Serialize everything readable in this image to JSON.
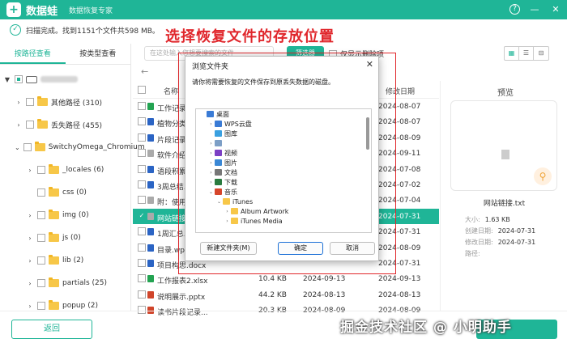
{
  "app": {
    "brand": "数据蛙",
    "subtitle": "数据恢复专家",
    "help": "?",
    "minimize": "—",
    "close": "✕",
    "logo": "+"
  },
  "status": {
    "text": "扫描完成。找到1151个文件共598 MB。"
  },
  "annotation": "选择恢复文件的存放位置",
  "tabs": [
    {
      "label": "按路径查看"
    },
    {
      "label": "按类型查看"
    }
  ],
  "tree": [
    {
      "label": "其他路径 (310)"
    },
    {
      "label": "丢失路径 (455)"
    },
    {
      "label": "SwitchyOmega_Chromium"
    },
    {
      "label": "_locales (6)"
    },
    {
      "label": "css (0)"
    },
    {
      "label": "img (0)"
    },
    {
      "label": "js (0)"
    },
    {
      "label": "lib (2)"
    },
    {
      "label": "partials (25)"
    },
    {
      "label": "popup (2)"
    }
  ],
  "toolbar": {
    "search_placeholder": "在这处输入您想要搜索的文件",
    "filter_label": "筛选器",
    "only_deleted": "仅显示删除项"
  },
  "view": {
    "grid": "▦",
    "list": "☰",
    "detail": "⊟"
  },
  "nav": {
    "back": "←"
  },
  "list": {
    "col_name": "名称",
    "col_date": "修改日期",
    "rows": [
      {
        "name": "工作记录表",
        "size": "",
        "type": "",
        "date": "2024-08-07",
        "icon": "x"
      },
      {
        "name": "植物分类.d",
        "size": "",
        "type": "",
        "date": "2024-08-07",
        "icon": "w"
      },
      {
        "name": "片段记录.d",
        "size": "",
        "type": "",
        "date": "2024-08-09",
        "icon": "w"
      },
      {
        "name": "软件介绍 -",
        "size": "",
        "type": "",
        "date": "2024-09-11",
        "icon": "t"
      },
      {
        "name": "语段积累.d",
        "size": "",
        "type": "",
        "date": "2024-07-08",
        "icon": "w"
      },
      {
        "name": "3周总结.do",
        "size": "",
        "type": "",
        "date": "2024-07-02",
        "icon": "w"
      },
      {
        "name": "附：使用流",
        "size": "",
        "type": "",
        "date": "2024-07-04",
        "icon": "t"
      },
      {
        "name": "网站链接.tx",
        "size": "",
        "type": "",
        "date": "2024-07-31",
        "icon": "t",
        "selected": true
      },
      {
        "name": "1周汇总.do",
        "size": "",
        "type": "",
        "date": "2024-07-31",
        "icon": "w"
      },
      {
        "name": "目录.wps",
        "size": "",
        "type": "",
        "date": "2024-08-09",
        "icon": "w"
      },
      {
        "name": "项目构思.docx",
        "size": "",
        "type": "",
        "date": "2024-07-31",
        "icon": "w"
      },
      {
        "name": "工作报表2.xlsx",
        "size": "10.4 KB",
        "type": "2024-09-13",
        "date": "2024-09-13",
        "icon": "x"
      },
      {
        "name": "说明展示.pptx",
        "size": "44.2 KB",
        "type": "2024-08-13",
        "date": "2024-08-13",
        "icon": "p"
      },
      {
        "name": "读书片段记录...",
        "size": "20.3 KB",
        "type": "2024-08-09",
        "date": "2024-08-09",
        "icon": "p"
      }
    ]
  },
  "preview": {
    "title": "预览",
    "filename": "网站链接.txt",
    "size_label": "大小:",
    "size": "1.63 KB",
    "created_label": "创建日期:",
    "created": "2024-07-31",
    "modified_label": "修改日期:",
    "modified": "2024-07-31",
    "path_label": "路径:",
    "magnifier": "⚲"
  },
  "dialog": {
    "title": "浏览文件夹",
    "close": "✕",
    "message": "请你将需要恢复的文件保存到原丢失数据的磁盘。",
    "tree": [
      {
        "label": "桌面",
        "indent": 0,
        "chev": "",
        "color": "#3a7bd5"
      },
      {
        "label": "WPS云盘",
        "indent": 1,
        "chev": "›",
        "color": "#3a7bd5"
      },
      {
        "label": "图库",
        "indent": 1,
        "chev": "",
        "color": "#3aa0e0"
      },
      {
        "label": "",
        "indent": 1,
        "chev": "›",
        "color": "#7d9fc6"
      },
      {
        "label": "视频",
        "indent": 1,
        "chev": "›",
        "color": "#7b3fc4"
      },
      {
        "label": "图片",
        "indent": 1,
        "chev": "›",
        "color": "#3a87d5"
      },
      {
        "label": "文档",
        "indent": 1,
        "chev": "›",
        "color": "#777"
      },
      {
        "label": "下载",
        "indent": 1,
        "chev": "›",
        "color": "#2a7b3f"
      },
      {
        "label": "音乐",
        "indent": 1,
        "chev": "⌄",
        "color": "#d6452b"
      },
      {
        "label": "iTunes",
        "indent": 2,
        "chev": "⌄",
        "color": "#f7c748"
      },
      {
        "label": "Album Artwork",
        "indent": 3,
        "chev": "›",
        "color": "#f7c748"
      },
      {
        "label": "iTunes Media",
        "indent": 3,
        "chev": "›",
        "color": "#f7c748"
      }
    ],
    "new_folder": "新建文件夹(M)",
    "ok": "确定",
    "cancel": "取消"
  },
  "bottom": {
    "back_label": "返回"
  },
  "watermark": "掘金技术社区 @ 小明助手"
}
